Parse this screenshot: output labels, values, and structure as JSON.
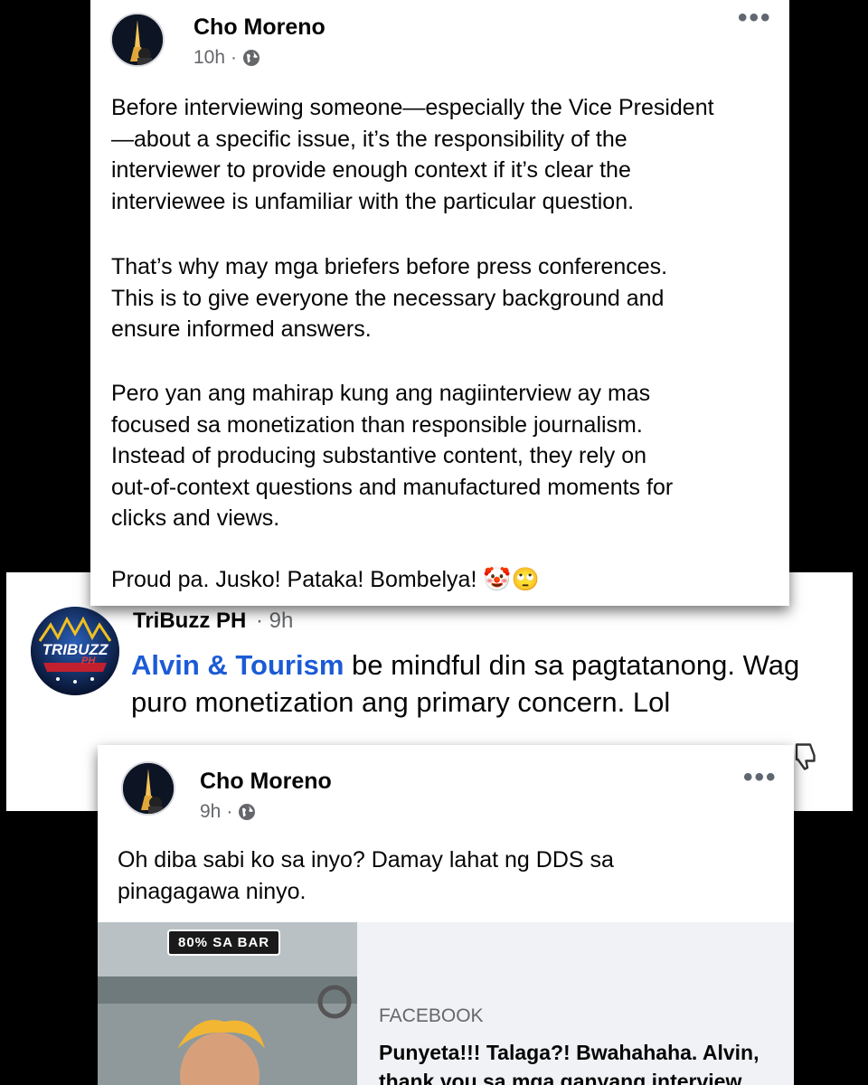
{
  "post1": {
    "author": "Cho Moreno",
    "time": "10h",
    "more_label": "•••",
    "paragraphs": [
      "Before interviewing someone—especially the Vice President\n—about a specific issue, it’s the responsibility of the\ninterviewer to provide enough context if it’s clear the\ninterviewee is unfamiliar with the particular question.",
      "That’s why may mga briefers before press conferences.\nThis is to give everyone the necessary background and\nensure informed answers.",
      "Pero yan ang mahirap kung ang nagiinterview ay mas\nfocused sa monetization than responsible journalism.\nInstead of producing substantive content, they rely on\nout-of-context questions and manufactured moments for\nclicks and views.",
      "Proud pa. Jusko! Pataka! Bombelya! 🤡🙄"
    ]
  },
  "comment": {
    "author": "TriBuzz PH",
    "time": "· 9h",
    "mention": "Alvin & Tourism",
    "text": " be mindful din sa pagtatanong. Wag puro monetization ang primary concern. Lol",
    "avatar_logo_text": "TRIBUZZ",
    "avatar_logo_sub": "PH"
  },
  "post2": {
    "author": "Cho Moreno",
    "time": "9h",
    "more_label": "•••",
    "text": "Oh diba sabi ko sa inyo? Damay lahat ng DDS sa\npinagagawa ninyo.",
    "link_preview": {
      "badge": "80% SA BAR",
      "source": "FACEBOOK",
      "title": "Punyeta!!! Talaga?! Bwahahaha. Alvin, thank you sa mga ganyang interview"
    }
  },
  "icons": {
    "privacy": "globe-icon",
    "more": "more-options-icon",
    "reaction": "dislike-icon"
  },
  "colors": {
    "mention": "#1b5bd6",
    "meta": "#65676b",
    "background": "#000000"
  }
}
